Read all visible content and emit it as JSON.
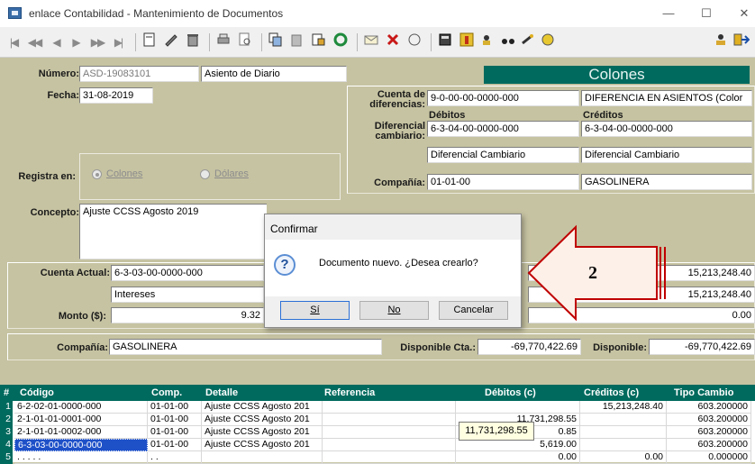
{
  "window": {
    "title": "enlace Contabilidad - Mantenimiento de Documentos",
    "minimize_glyph": "—",
    "maximize_glyph": "☐",
    "close_glyph": "✕"
  },
  "toolbar": {
    "nav": [
      "|◀",
      "◀◀",
      "◀",
      "▶",
      "▶▶",
      "▶|"
    ],
    "icons": [
      "new-doc-icon",
      "edit-icon",
      "delete-icon",
      "print-icon",
      "preview-icon",
      "copy-icon",
      "paste-icon",
      "find-icon",
      "refresh-icon",
      "mail-icon",
      "cancel-icon",
      "help-icon",
      "print-report-icon",
      "tree-icon",
      "users-icon",
      "binoculars-icon",
      "key-icon",
      "coins-icon",
      "user-icon",
      "exit-icon"
    ]
  },
  "header": {
    "numero_label": "Número:",
    "numero_value": "ASD-19083101",
    "tipo_value": "Asiento de Diario",
    "currency_banner": "Colones",
    "fecha_label": "Fecha:",
    "fecha_value": "31-08-2019",
    "cuenta_dif_label": "Cuenta de diferencias:",
    "cuenta_dif_value": "9-0-00-00-0000-000",
    "cuenta_dif_desc": "DIFERENCIA EN ASIENTOS (Color",
    "debitos_label": "Débitos",
    "creditos_label": "Créditos",
    "dif_cambiario_label": "Diferencial cambiario:",
    "dif_debitos_value": "6-3-04-00-0000-000",
    "dif_creditos_value": "6-3-04-00-0000-000",
    "dif_debitos_desc": "Diferencial Cambiario",
    "dif_creditos_desc": "Diferencial Cambiario",
    "registra_label": "Registra en:",
    "radio_colones": "Colones",
    "radio_dolares": "Dólares",
    "compania_label": "Compañía:",
    "compania_code": "01-01-00",
    "compania_name": "GASOLINERA",
    "concepto_label": "Concepto:",
    "concepto_value": "Ajuste CCSS Agosto 2019"
  },
  "detail": {
    "cuenta_actual_label": "Cuenta Actual:",
    "cuenta_actual_value": "6-3-03-00-0000-000",
    "cuenta_actual_desc": "Intereses",
    "monto_label": "Monto ($):",
    "monto_value": "9.32",
    "right_value_1": "15,213,248.40",
    "right_value_2": "15,213,248.40",
    "right_value_3": "0.00",
    "compania_label": "Compañía:",
    "compania_value": "GASOLINERA",
    "disp_cta_label": "Disponible Cta.:",
    "disp_cta_value": "-69,770,422.69",
    "disponible_label": "Disponible:",
    "disponible_value": "-69,770,422.69"
  },
  "grid": {
    "headers": [
      "#",
      "Código",
      "Comp.",
      "Detalle",
      "Referencia",
      "Débitos (c)",
      "Créditos (c)",
      "Tipo Cambio"
    ],
    "rows": [
      {
        "n": "1",
        "codigo": "6-2-02-01-0000-000",
        "comp": "01-01-00",
        "detalle": "Ajuste CCSS Agosto 201",
        "ref": "",
        "debitos": "",
        "creditos": "15,213,248.40",
        "tc": "603.200000"
      },
      {
        "n": "2",
        "codigo": "2-1-01-01-0001-000",
        "comp": "01-01-00",
        "detalle": "Ajuste CCSS Agosto 201",
        "ref": "",
        "debitos": "11,731,298.55",
        "creditos": "",
        "tc": "603.200000"
      },
      {
        "n": "3",
        "codigo": "2-1-01-01-0002-000",
        "comp": "01-01-00",
        "detalle": "Ajuste CCSS Agosto 201",
        "ref": "",
        "debitos": "0.85",
        "creditos": "",
        "tc": "603.200000"
      },
      {
        "n": "4",
        "codigo": "6-3-03-00-0000-000",
        "comp": "01-01-00",
        "detalle": "Ajuste CCSS Agosto 201",
        "ref": "",
        "debitos": "5,619.00",
        "creditos": "",
        "tc": "603.200000"
      },
      {
        "n": "5",
        "codigo": ". . . .  .",
        "comp": ". .",
        "detalle": "",
        "ref": "",
        "debitos": "0.00",
        "creditos": "0.00",
        "tc": "0.000000"
      }
    ],
    "tooltip": "11,731,298.55"
  },
  "dialog": {
    "title": "Confirmar",
    "message": "Documento nuevo. ¿Desea crearlo?",
    "icon": "?",
    "yes": "Sí",
    "no": "No",
    "cancel": "Cancelar"
  },
  "annotation": {
    "number": "2",
    "color": "#c00000"
  }
}
